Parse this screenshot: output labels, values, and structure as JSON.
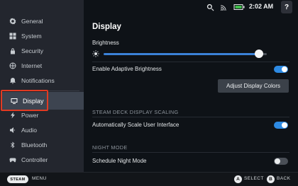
{
  "sidebar": {
    "items": [
      {
        "label": "General",
        "icon": "gear-icon"
      },
      {
        "label": "System",
        "icon": "grid-icon"
      },
      {
        "label": "Security",
        "icon": "lock-icon"
      },
      {
        "label": "Internet",
        "icon": "globe-icon"
      },
      {
        "label": "Notifications",
        "icon": "bell-icon"
      },
      {
        "label": "Display",
        "icon": "monitor-icon",
        "active": true
      },
      {
        "label": "Power",
        "icon": "bolt-icon"
      },
      {
        "label": "Audio",
        "icon": "speaker-icon"
      },
      {
        "label": "Bluetooth",
        "icon": "bluetooth-icon"
      },
      {
        "label": "Controller",
        "icon": "gamepad-icon"
      }
    ]
  },
  "topbar": {
    "icons": [
      "search-icon",
      "wifi-icon",
      "battery-icon"
    ],
    "time": "2:02 AM",
    "help": "?"
  },
  "display": {
    "title": "Display",
    "brightness_label": "Brightness",
    "brightness_level": 0.95,
    "adaptive_label": "Enable Adaptive Brightness",
    "adaptive_on": true,
    "adjust_colors_label": "Adjust Display Colors",
    "scaling_section": "STEAM DECK DISPLAY SCALING",
    "auto_scale_label": "Automatically Scale User Interface",
    "auto_scale_on": true,
    "night_section": "NIGHT MODE",
    "schedule_label": "Schedule Night Mode",
    "schedule_on": false
  },
  "colors": {
    "accent": "#2d8ae3",
    "focus": "#e33a22"
  },
  "footer": {
    "steam": "STEAM",
    "menu": "MENU",
    "a": "A",
    "select": "SELECT",
    "b": "B",
    "back": "BACK"
  }
}
